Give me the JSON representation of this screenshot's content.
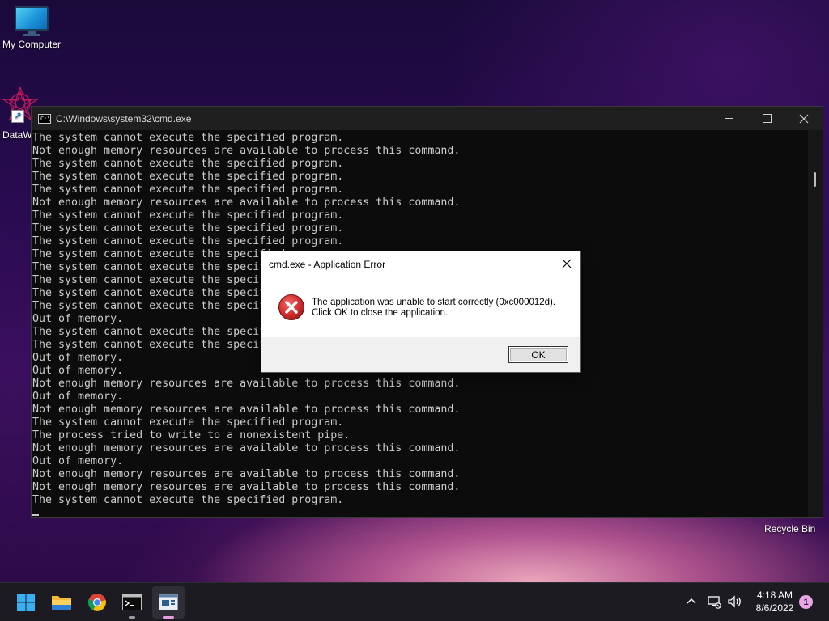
{
  "desktop": {
    "icons": [
      {
        "label": "My Computer",
        "icon": "monitor-icon"
      },
      {
        "label": "DataW",
        "icon": "datawrapper-icon"
      }
    ],
    "recycle_bin_label": "Recycle Bin"
  },
  "cmd_window": {
    "title": "C:\\Windows\\system32\\cmd.exe",
    "icon": "cmd-icon",
    "icon_text": "C:\\",
    "controls": [
      "minimize-icon",
      "maximize-icon",
      "close-icon"
    ],
    "lines": [
      "The system cannot execute the specified program.",
      "Not enough memory resources are available to process this command.",
      "The system cannot execute the specified program.",
      "The system cannot execute the specified program.",
      "The system cannot execute the specified program.",
      "Not enough memory resources are available to process this command.",
      "The system cannot execute the specified program.",
      "The system cannot execute the specified program.",
      "The system cannot execute the specified program.",
      "The system cannot execute the specified program.",
      "The system cannot execute the specified program.",
      "The system cannot execute the specified program.",
      "The system cannot execute the specified program.",
      "The system cannot execute the specified program.",
      "Out of memory.",
      "The system cannot execute the specified program.",
      "The system cannot execute the specified program.",
      "Out of memory.",
      "Out of memory.",
      "Not enough memory resources are available to process this command.",
      "Out of memory.",
      "Not enough memory resources are available to process this command.",
      "The system cannot execute the specified program.",
      "The process tried to write to a nonexistent pipe.",
      "Not enough memory resources are available to process this command.",
      "Out of memory.",
      "Not enough memory resources are available to process this command.",
      "Not enough memory resources are available to process this command.",
      "The system cannot execute the specified program."
    ]
  },
  "error_dialog": {
    "title": "cmd.exe - Application Error",
    "icon": "error-icon",
    "message_line1": "The application was unable to start correctly (0xc000012d).",
    "message_line2": "Click OK to close the application.",
    "ok_label": "OK"
  },
  "taskbar": {
    "items": [
      "windows-start-icon",
      "file-explorer-icon",
      "chrome-icon",
      "cmd-icon",
      "app-icon"
    ],
    "tray": [
      "chevron-up-icon",
      "network-icon",
      "volume-icon"
    ],
    "time": "4:18 AM",
    "date": "8/6/2022",
    "notification_count": "1"
  },
  "colors": {
    "console_bg": "#0c0c0c",
    "console_text": "#cccccc",
    "taskbar_bg": "#1c1b22",
    "error_red": "#d32f2f",
    "badge": "#e8a6e6"
  }
}
